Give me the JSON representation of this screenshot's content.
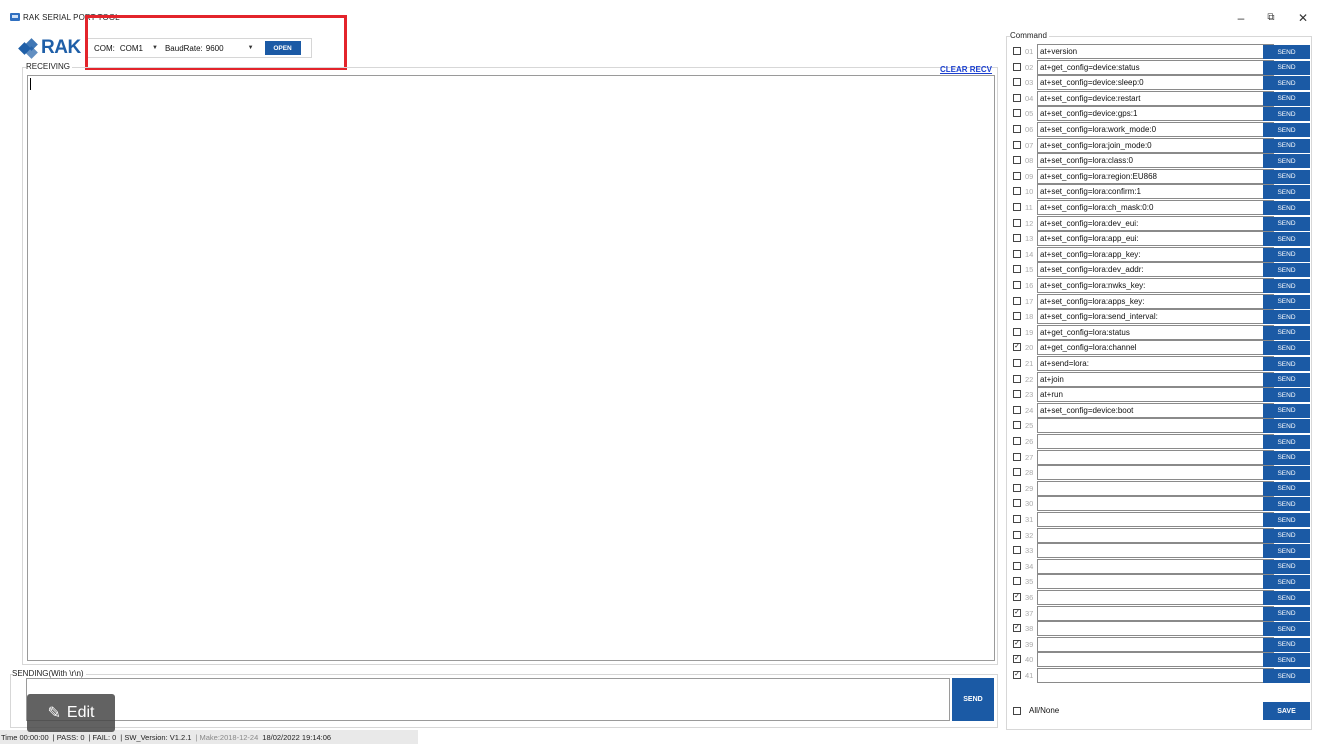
{
  "window": {
    "title": "RAK SERIAL PORT TOOL",
    "minimize": "–",
    "maximize": "⧉",
    "close": "✕"
  },
  "logo": {
    "text": "RAK"
  },
  "com": {
    "com_label": "COM:",
    "com_value": "COM1",
    "baud_label": "BaudRate:",
    "baud_value": "9600",
    "open_label": "OPEN"
  },
  "receiving": {
    "label": "RECEIVING",
    "clear_label": "CLEAR RECV",
    "content": ""
  },
  "sending": {
    "label": "SENDING(With \\r\\n)",
    "value": "",
    "send_label": "SEND"
  },
  "edit": {
    "label": "Edit"
  },
  "status": {
    "time": "Time 00:00:00",
    "pass": "| PASS: 0",
    "fail": "| FAIL: 0",
    "sw": "| SW_Version: V1.2.1",
    "make": "| Make:2018-12-24",
    "datetime": "18/02/2022 19:14:06"
  },
  "command": {
    "title": "Command",
    "send_label": "SEND",
    "allnone_label": "All/None",
    "save_label": "SAVE",
    "rows": [
      {
        "num": "01",
        "text": "at+version",
        "checked": false
      },
      {
        "num": "02",
        "text": "at+get_config=device:status",
        "checked": false
      },
      {
        "num": "03",
        "text": "at+set_config=device:sleep:0",
        "checked": false
      },
      {
        "num": "04",
        "text": "at+set_config=device:restart",
        "checked": false
      },
      {
        "num": "05",
        "text": "at+set_config=device:gps:1",
        "checked": false
      },
      {
        "num": "06",
        "text": "at+set_config=lora:work_mode:0",
        "checked": false
      },
      {
        "num": "07",
        "text": "at+set_config=lora:join_mode:0",
        "checked": false
      },
      {
        "num": "08",
        "text": "at+set_config=lora:class:0",
        "checked": false
      },
      {
        "num": "09",
        "text": "at+set_config=lora:region:EU868",
        "checked": false
      },
      {
        "num": "10",
        "text": "at+set_config=lora:confirm:1",
        "checked": false
      },
      {
        "num": "11",
        "text": "at+set_config=lora:ch_mask:0:0",
        "checked": false
      },
      {
        "num": "12",
        "text": "at+set_config=lora:dev_eui:",
        "checked": false
      },
      {
        "num": "13",
        "text": "at+set_config=lora:app_eui:",
        "checked": false
      },
      {
        "num": "14",
        "text": "at+set_config=lora:app_key:",
        "checked": false
      },
      {
        "num": "15",
        "text": "at+set_config=lora:dev_addr:",
        "checked": false
      },
      {
        "num": "16",
        "text": "at+set_config=lora:nwks_key:",
        "checked": false
      },
      {
        "num": "17",
        "text": "at+set_config=lora:apps_key:",
        "checked": false
      },
      {
        "num": "18",
        "text": "at+set_config=lora:send_interval:",
        "checked": false
      },
      {
        "num": "19",
        "text": "at+get_config=lora:status",
        "checked": false
      },
      {
        "num": "20",
        "text": "at+get_config=lora:channel",
        "checked": true
      },
      {
        "num": "21",
        "text": "at+send=lora:",
        "checked": false
      },
      {
        "num": "22",
        "text": "at+join",
        "checked": false
      },
      {
        "num": "23",
        "text": "at+run",
        "checked": false
      },
      {
        "num": "24",
        "text": "at+set_config=device:boot",
        "checked": false
      },
      {
        "num": "25",
        "text": "",
        "checked": false
      },
      {
        "num": "26",
        "text": "",
        "checked": false
      },
      {
        "num": "27",
        "text": "",
        "checked": false
      },
      {
        "num": "28",
        "text": "",
        "checked": false
      },
      {
        "num": "29",
        "text": "",
        "checked": false
      },
      {
        "num": "30",
        "text": "",
        "checked": false
      },
      {
        "num": "31",
        "text": "",
        "checked": false
      },
      {
        "num": "32",
        "text": "",
        "checked": false
      },
      {
        "num": "33",
        "text": "",
        "checked": false
      },
      {
        "num": "34",
        "text": "",
        "checked": false
      },
      {
        "num": "35",
        "text": "",
        "checked": false
      },
      {
        "num": "36",
        "text": "",
        "checked": true
      },
      {
        "num": "37",
        "text": "",
        "checked": true
      },
      {
        "num": "38",
        "text": "",
        "checked": true
      },
      {
        "num": "39",
        "text": "",
        "checked": true
      },
      {
        "num": "40",
        "text": "",
        "checked": true
      },
      {
        "num": "41",
        "text": "",
        "checked": true
      }
    ]
  },
  "colors": {
    "accent": "#1b5aa5",
    "highlight": "#e3242b",
    "link": "#1a3fd0"
  }
}
